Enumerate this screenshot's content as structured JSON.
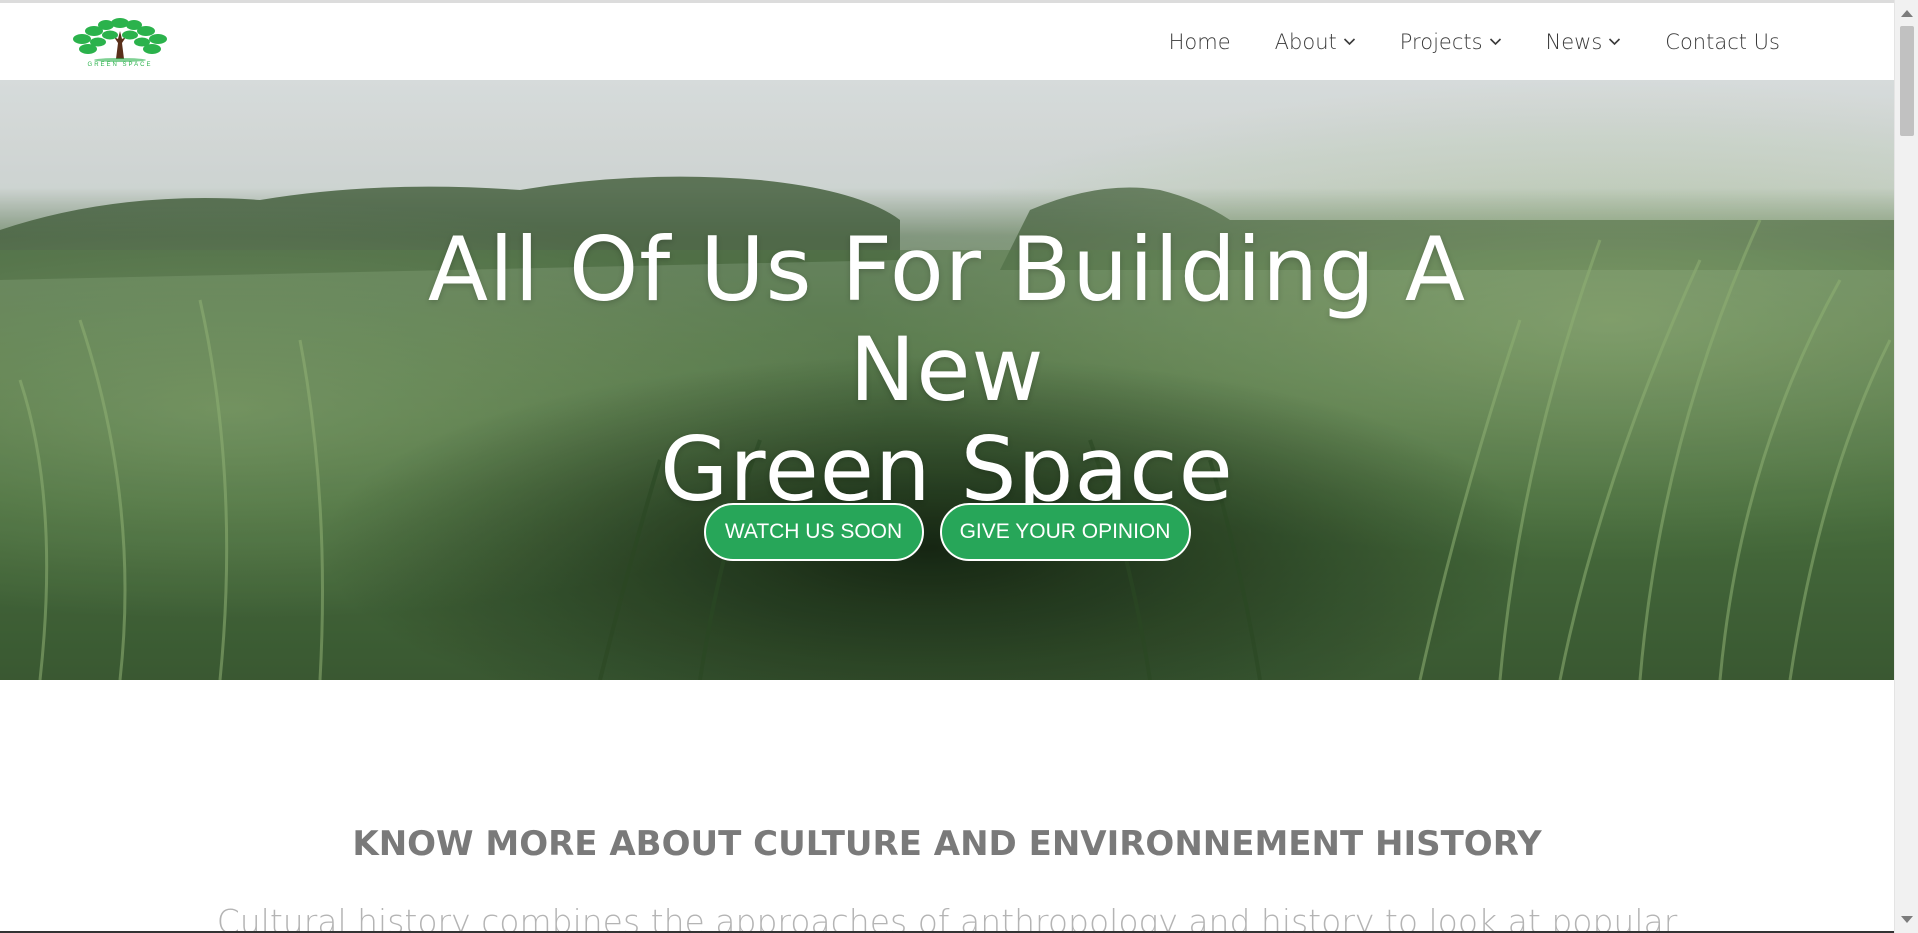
{
  "brand": {
    "logo_caption": "GREEN SPACE",
    "colors": {
      "primary": "#27a659",
      "tree_leaf": "#2bb24c",
      "trunk": "#5a2f1a"
    }
  },
  "nav": {
    "items": [
      {
        "label": "Home",
        "has_dropdown": false,
        "icon": ""
      },
      {
        "label": "About",
        "has_dropdown": true,
        "icon": "chevron-down-icon"
      },
      {
        "label": "Projects",
        "has_dropdown": true,
        "icon": "chevron-down-icon"
      },
      {
        "label": "News",
        "has_dropdown": true,
        "icon": "chevron-down-icon"
      },
      {
        "label": "Contact Us",
        "has_dropdown": false,
        "icon": ""
      }
    ]
  },
  "hero": {
    "title_line1": "All Of Us For Building A New",
    "title_line2": "Green Space",
    "buttons": [
      {
        "label": "WATCH US SOON"
      },
      {
        "label": "GIVE YOUR OPINION"
      }
    ]
  },
  "section": {
    "heading": "KNOW MORE ABOUT CULTURE AND ENVIRONNEMENT HISTORY",
    "text_partial": "Cultural history combines the approaches of anthropology and history to look at popular"
  }
}
